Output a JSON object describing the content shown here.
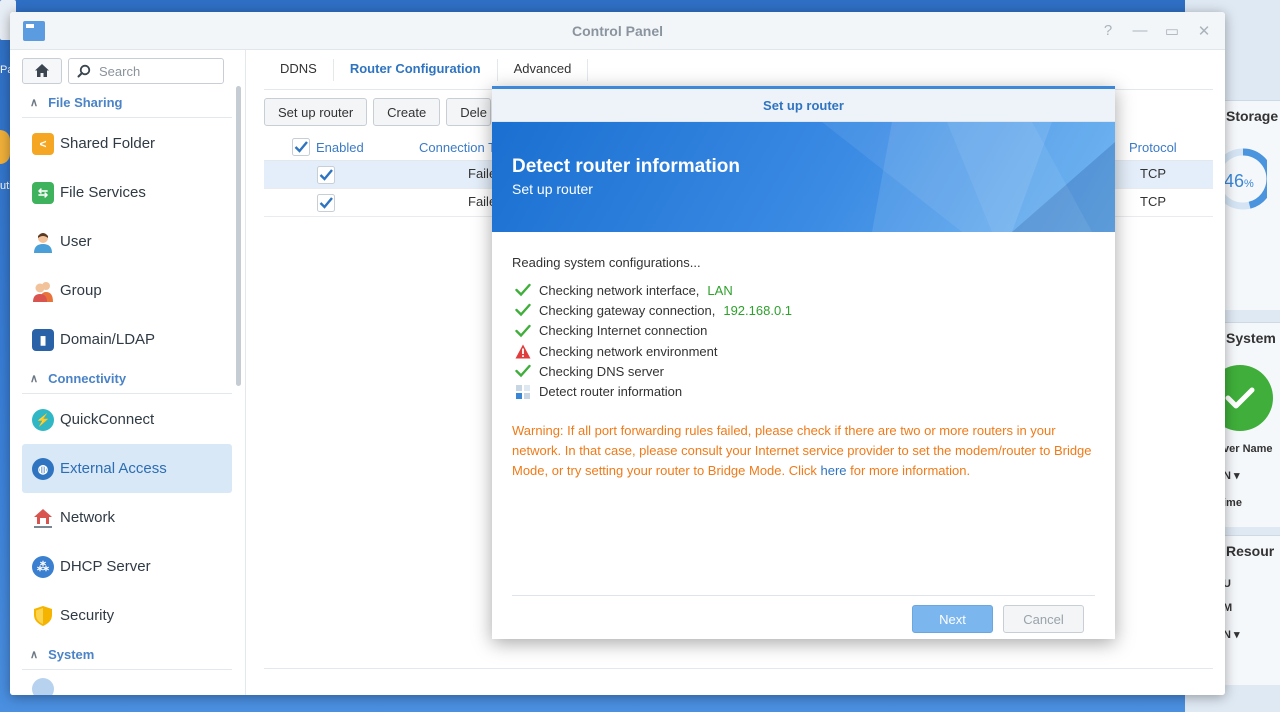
{
  "desktop": {
    "label_1": "Pa",
    "label_2": "uti"
  },
  "window": {
    "title": "Control Panel"
  },
  "sidebar": {
    "search_placeholder": "Search",
    "sections": [
      {
        "label": "File Sharing"
      },
      {
        "label": "Connectivity"
      },
      {
        "label": "System"
      }
    ],
    "items": [
      {
        "label": "Shared Folder",
        "icon": "shared-folder-icon",
        "color": "#f5a623"
      },
      {
        "label": "File Services",
        "icon": "file-services-icon",
        "color": "#3fb25e"
      },
      {
        "label": "User",
        "icon": "user-icon",
        "color": "#4a9fd8"
      },
      {
        "label": "Group",
        "icon": "group-icon",
        "color": "#e8743b"
      },
      {
        "label": "Domain/LDAP",
        "icon": "domain-ldap-icon",
        "color": "#2a62a8"
      },
      {
        "label": "QuickConnect",
        "icon": "quickconnect-icon",
        "color": "#2fb7c6"
      },
      {
        "label": "External Access",
        "icon": "globe-icon",
        "color": "#2f74c0"
      },
      {
        "label": "Network",
        "icon": "network-icon",
        "color": "#d9534f"
      },
      {
        "label": "DHCP Server",
        "icon": "dhcp-server-icon",
        "color": "#3a7fd0"
      },
      {
        "label": "Security",
        "icon": "shield-icon",
        "color": "#f5b400"
      }
    ],
    "active_item": "External Access"
  },
  "tabs": [
    {
      "label": "DDNS"
    },
    {
      "label": "Router Configuration"
    },
    {
      "label": "Advanced"
    }
  ],
  "toolbar": {
    "setup_router": "Set up router",
    "create": "Create",
    "delete_partial": "Dele"
  },
  "grid": {
    "headers": {
      "enabled": "Enabled",
      "connection_partial": "Connection T",
      "protocol": "Protocol"
    },
    "rows": [
      {
        "enabled": true,
        "status_partial": "Faile",
        "protocol": "TCP"
      },
      {
        "enabled": true,
        "status_partial": "Faile",
        "protocol": "TCP"
      }
    ]
  },
  "modal": {
    "title": "Set up router",
    "banner_title": "Detect router information",
    "banner_subtitle": "Set up router",
    "reading": "Reading system configurations...",
    "checks": [
      {
        "text": "Checking network interface, ",
        "value": "LAN",
        "status": "ok"
      },
      {
        "text": "Checking gateway connection, ",
        "value": "192.168.0.1",
        "status": "ok"
      },
      {
        "text": "Checking Internet connection",
        "value": "",
        "status": "ok"
      },
      {
        "text": "Checking network environment",
        "value": "",
        "status": "warning"
      },
      {
        "text": "Checking DNS server",
        "value": "",
        "status": "ok"
      },
      {
        "text": "Detect router information",
        "value": "",
        "status": "loading"
      }
    ],
    "warning_pre": "Warning: If all port forwarding rules failed, please check if there are two or more routers in your network. In that case, please consult your Internet service provider to set the modem/router to Bridge Mode, or try setting your router to Bridge Mode. Click ",
    "warning_link": "here",
    "warning_post": " for more information.",
    "next": "Next",
    "cancel": "Cancel"
  },
  "widgets": {
    "storage": {
      "title": "Storage",
      "percent": 46,
      "percent_number": "46",
      "percent_sign": "%"
    },
    "system": {
      "title": "System",
      "lines": [
        "ver Name",
        "N ▾",
        "ime"
      ]
    },
    "resource": {
      "title": "Resour",
      "lines": [
        "U",
        "M",
        "N ▾"
      ]
    }
  },
  "colors": {
    "accent": "#2f74c0",
    "ok": "#3fae3a",
    "warning": "#f07a18",
    "alert": "#e03c3c"
  }
}
